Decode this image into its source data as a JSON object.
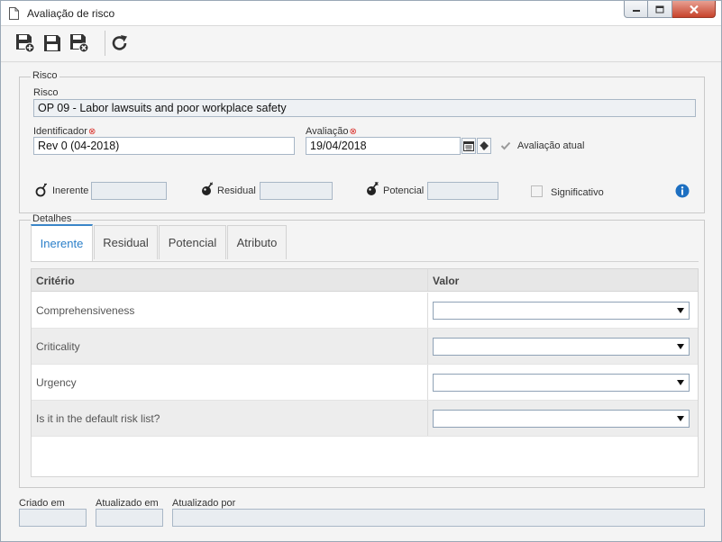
{
  "window": {
    "title": "Avaliação de risco"
  },
  "toolbar": {
    "buttons": [
      "save-and-new-icon",
      "save-icon",
      "save-and-close-icon",
      "refresh-icon"
    ]
  },
  "risco": {
    "legend": "Risco",
    "risco_label": "Risco",
    "risco_value": "OP 09 - Labor lawsuits and poor workplace safety",
    "identificador_label": "Identificador",
    "identificador_value": "Rev 0 (04-2018)",
    "avaliacao_label": "Avaliação",
    "avaliacao_value": "19/04/2018",
    "avaliacao_atual_label": "Avaliação atual",
    "avaliacao_atual_checked": true,
    "inerente_label": "Inerente",
    "inerente_value": "",
    "residual_label": "Residual",
    "residual_value": "",
    "potencial_label": "Potencial",
    "potencial_value": "",
    "significativo_label": "Significativo",
    "significativo_checked": false
  },
  "detalhes": {
    "legend": "Detalhes",
    "tabs": [
      {
        "label": "Inerente",
        "active": true
      },
      {
        "label": "Residual",
        "active": false
      },
      {
        "label": "Potencial",
        "active": false
      },
      {
        "label": "Atributo",
        "active": false
      }
    ],
    "columns": [
      "Critério",
      "Valor"
    ],
    "rows": [
      {
        "criterio": "Comprehensiveness",
        "valor": ""
      },
      {
        "criterio": "Criticality",
        "valor": ""
      },
      {
        "criterio": "Urgency",
        "valor": ""
      },
      {
        "criterio": "Is it in the default risk list?",
        "valor": ""
      }
    ]
  },
  "footer": {
    "criado_em_label": "Criado em",
    "criado_em_value": "",
    "atualizado_em_label": "Atualizado em",
    "atualizado_em_value": "",
    "atualizado_por_label": "Atualizado por",
    "atualizado_por_value": ""
  },
  "colors": {
    "accent": "#2b7fc9",
    "required": "#d9302a",
    "info": "#1d6fc1"
  }
}
